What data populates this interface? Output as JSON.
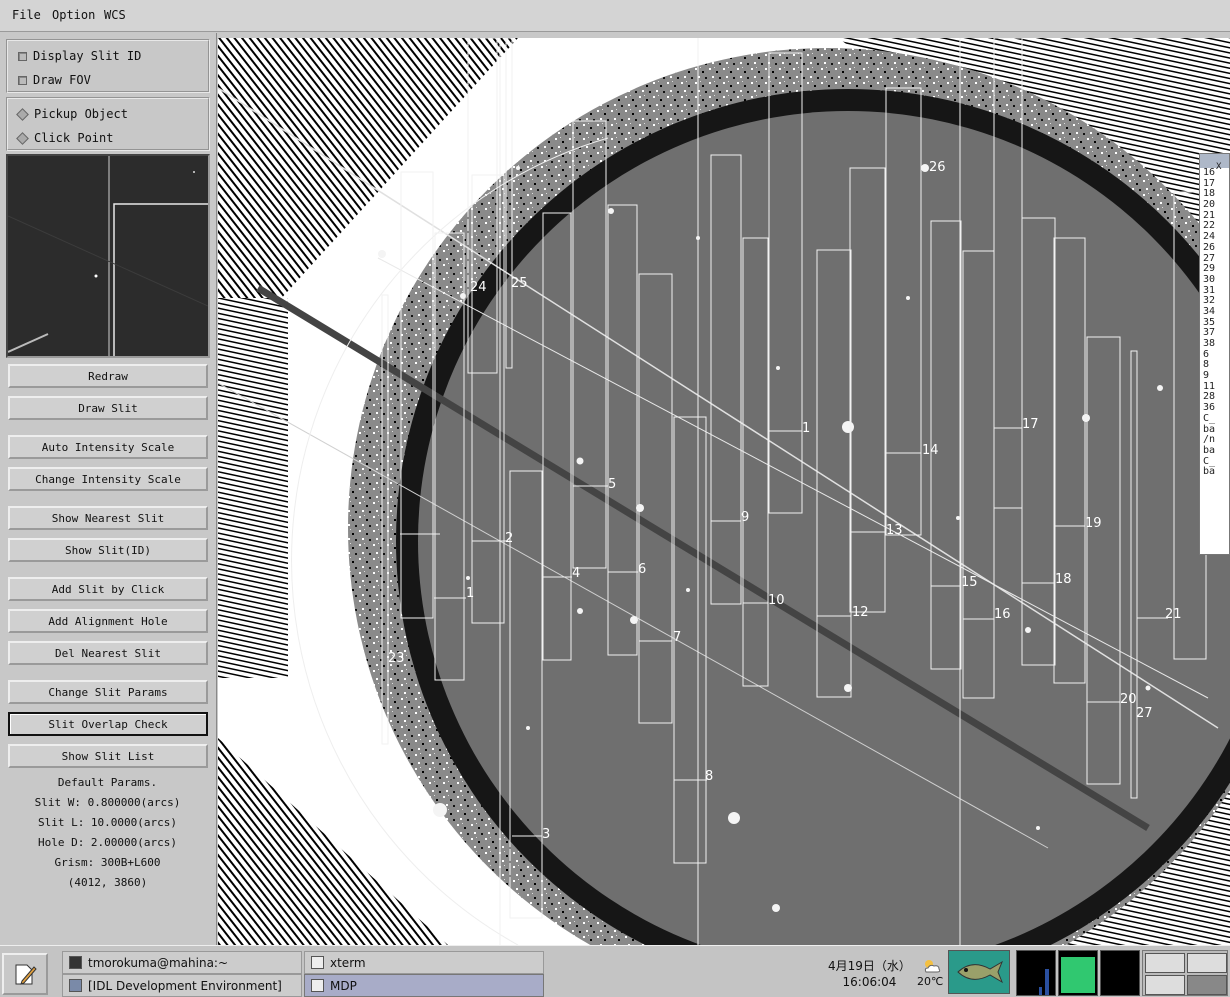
{
  "menu": {
    "file": "File",
    "option": "Option",
    "wcs": "WCS"
  },
  "checkboxes": {
    "display_slit_id": "Display Slit ID",
    "draw_fov": "Draw FOV"
  },
  "mode": {
    "pickup_object": "Pickup Object",
    "click_point": "Click Point"
  },
  "buttons": {
    "redraw": "Redraw",
    "draw_slit": "Draw Slit",
    "auto_intensity": "Auto Intensity Scale",
    "change_intensity": "Change Intensity Scale",
    "show_nearest": "Show Nearest Slit",
    "show_slit_id": "Show Slit(ID)",
    "add_slit_click": "Add Slit by Click",
    "add_alignment": "Add Alignment Hole",
    "del_nearest": "Del Nearest Slit",
    "change_params": "Change Slit Params",
    "overlap_check": "Slit Overlap Check",
    "show_list": "Show Slit List"
  },
  "params": {
    "title": "Default Params.",
    "slit_w": "Slit W: 0.800000(arcs)",
    "slit_l": "Slit L: 10.0000(arcs)",
    "hole_d": "Hole D: 2.00000(arcs)",
    "grism": "Grism: 300B+L600",
    "coords": "(4012, 3860)"
  },
  "slit_labels": {
    "s1": "1",
    "s2": "2",
    "s3": "3",
    "s4": "4",
    "s5": "5",
    "s6": "6",
    "s7": "7",
    "s8": "8",
    "s9": "9",
    "s10": "10",
    "s11": "1",
    "s12": "12",
    "s13": "13",
    "s14": "14",
    "s15": "15",
    "s16": "16",
    "s17": "17",
    "s18": "18",
    "s19": "19",
    "s20": "20",
    "s21": "21",
    "s23": "23",
    "s24": "24",
    "s25": "25",
    "s26": "26",
    "s27": "27"
  },
  "side_window": {
    "title": "X",
    "rows": [
      "16",
      "17",
      "18",
      "20",
      "21",
      "22",
      "24",
      "26",
      "27",
      "29",
      "30",
      "31",
      "32",
      "34",
      "35",
      "37",
      "38",
      "6",
      "8",
      "9",
      "11",
      "28",
      "36",
      "C_",
      "ba",
      "/n",
      "ba",
      "C_",
      "ba"
    ]
  },
  "taskbar": {
    "task1": "tmorokuma@mahina:~",
    "task2": "xterm",
    "task3": "[IDL Development Environment]",
    "task4": "MDP",
    "date": "4月19日（水）",
    "time": "16:06:04",
    "temperature": "20℃"
  }
}
